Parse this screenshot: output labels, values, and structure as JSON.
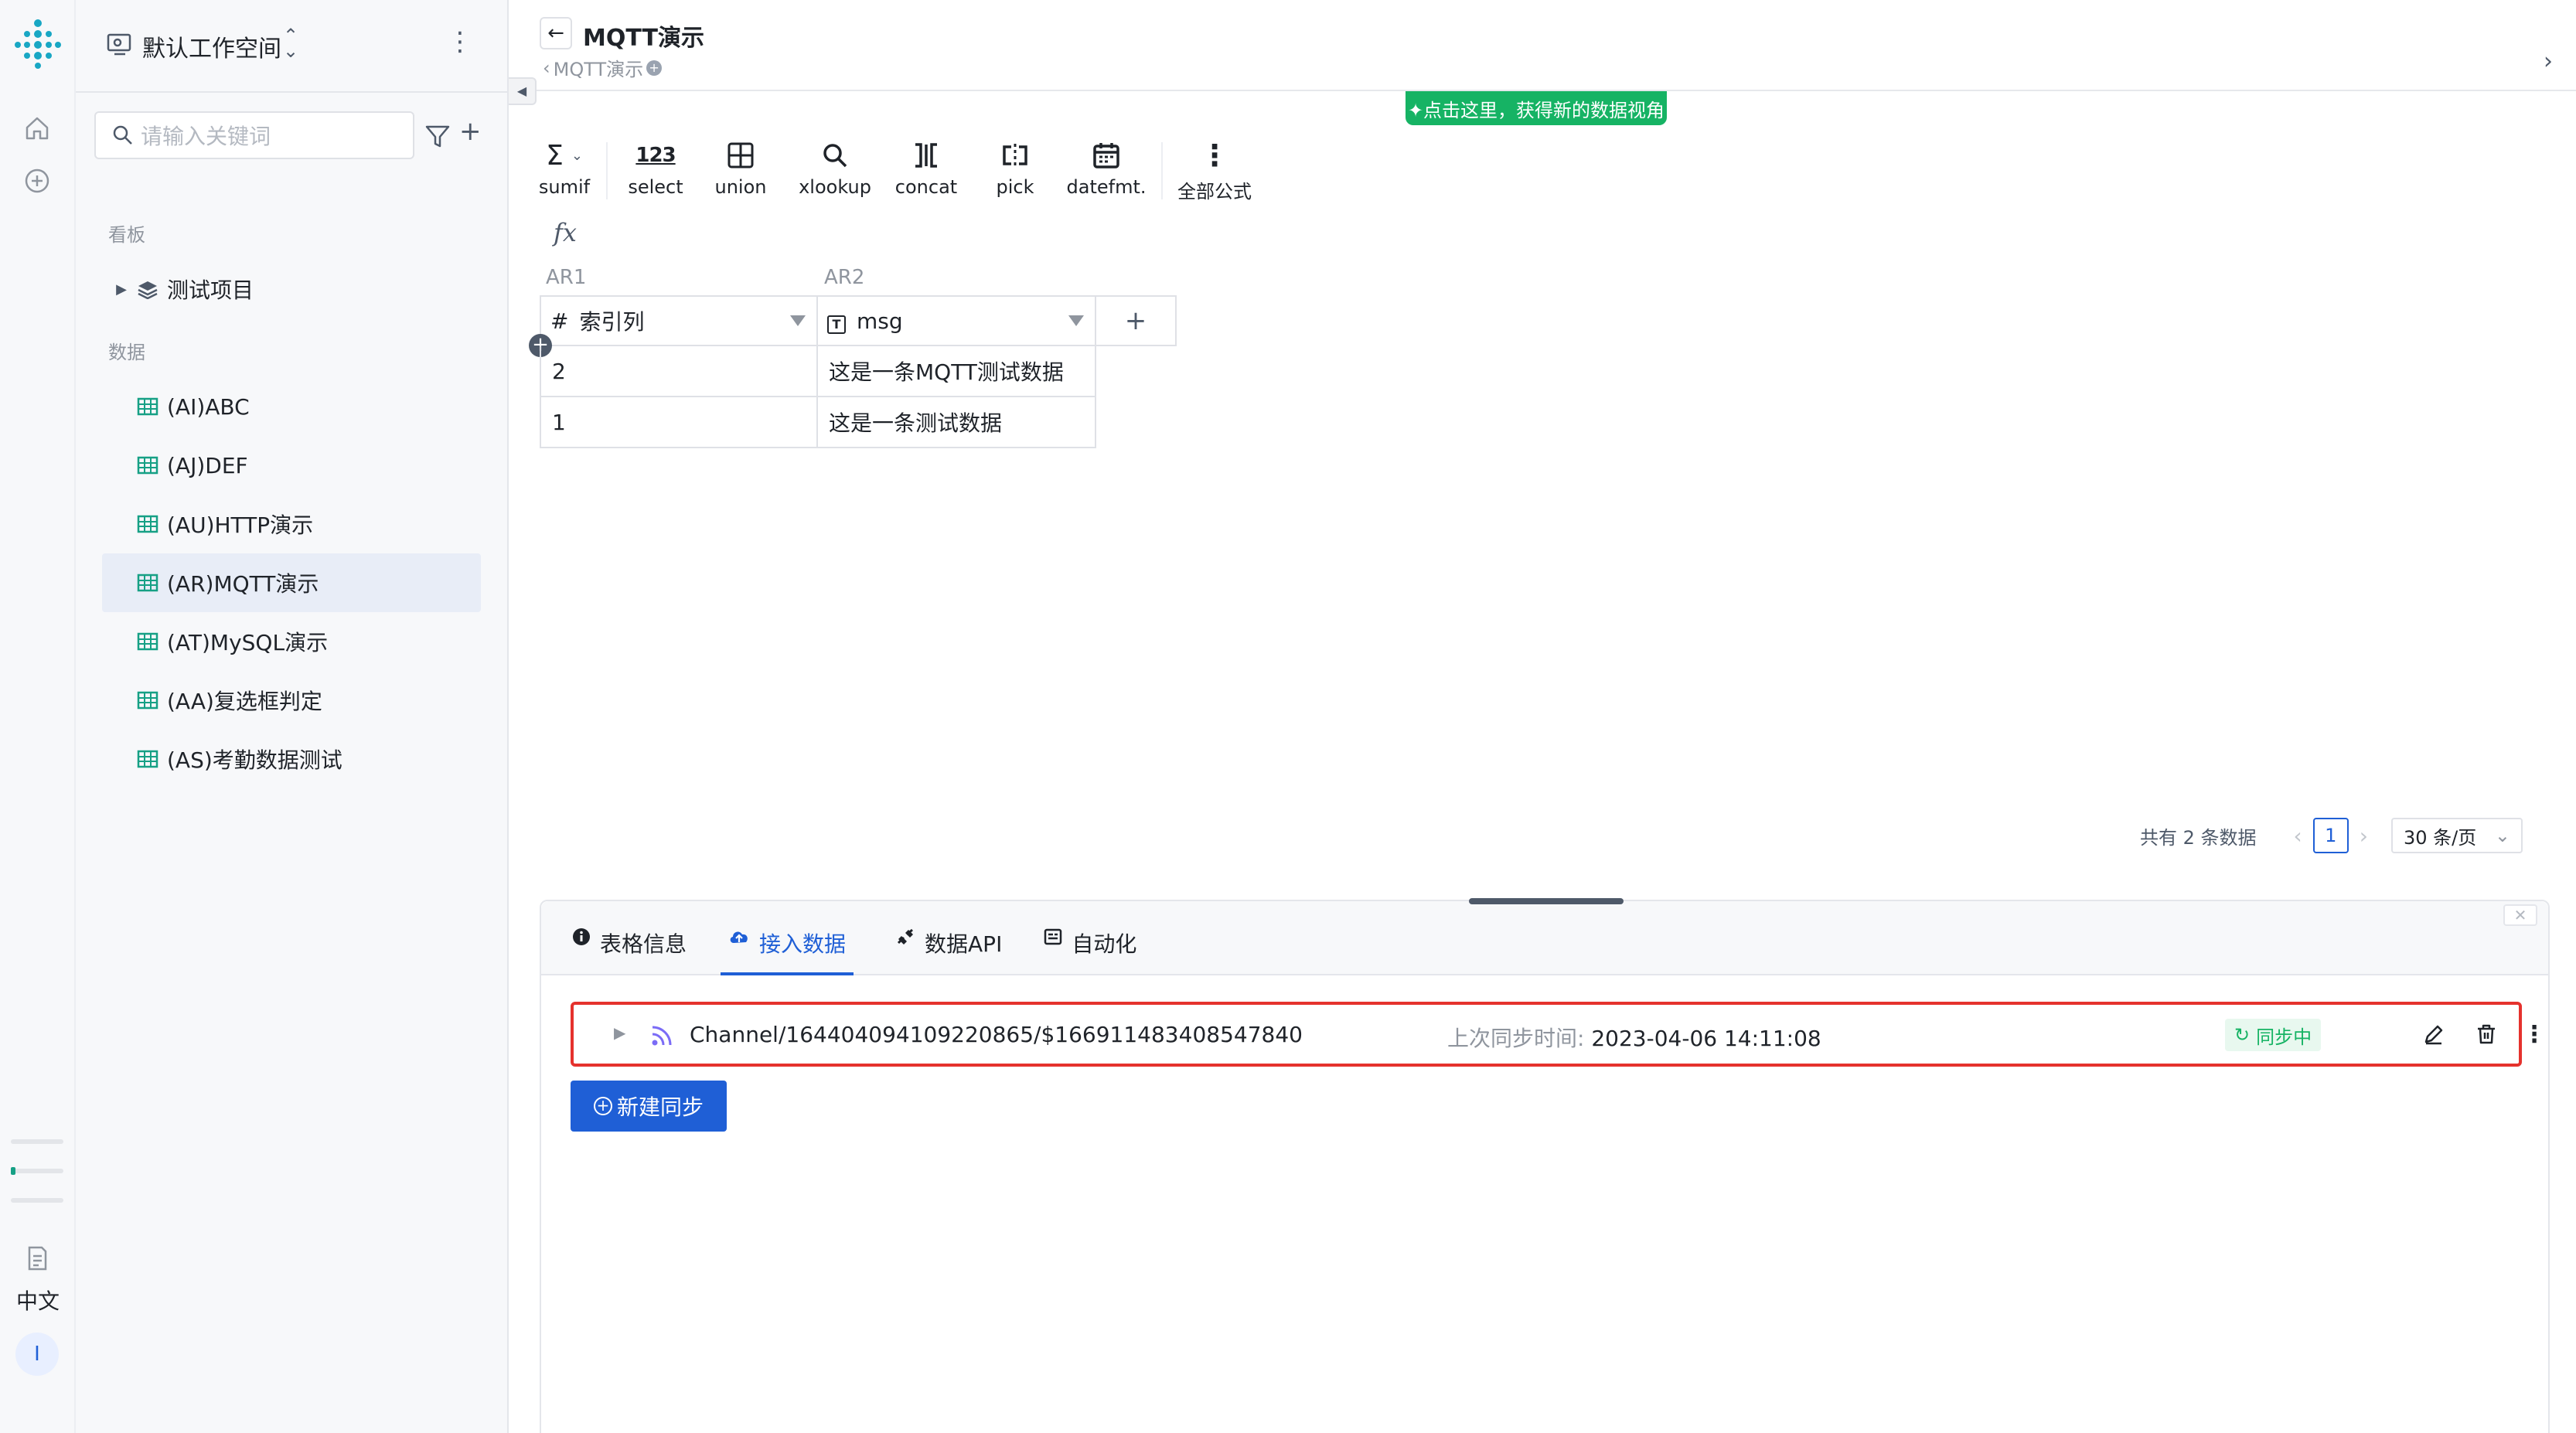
{
  "rail": {
    "lang_label": "中文",
    "avatar_initial": "I"
  },
  "sidebar": {
    "workspace_name": "默认工作空间",
    "search_placeholder": "请输入关键词",
    "section_board": "看板",
    "section_data": "数据",
    "board_items": [
      {
        "label": "测试项目"
      }
    ],
    "data_items": [
      {
        "label": "(AI)ABC"
      },
      {
        "label": "(AJ)DEF"
      },
      {
        "label": "(AU)HTTP演示"
      },
      {
        "label": "(AR)MQTT演示",
        "active": true
      },
      {
        "label": "(AT)MySQL演示"
      },
      {
        "label": "(AA)复选框判定"
      },
      {
        "label": "(AS)考勤数据测试"
      }
    ]
  },
  "header": {
    "title": "MQTT演示",
    "breadcrumb": "MQTT演示",
    "promo": "✦点击这里，获得新的数据视角"
  },
  "toolbar": {
    "tools": [
      {
        "icon": "sigma-icon",
        "label": "sumif"
      },
      {
        "icon": "number-icon",
        "label": "select"
      },
      {
        "icon": "union-icon",
        "label": "union"
      },
      {
        "icon": "search-icon",
        "label": "xlookup"
      },
      {
        "icon": "concat-icon",
        "label": "concat"
      },
      {
        "icon": "pick-icon",
        "label": "pick"
      },
      {
        "icon": "calendar-icon",
        "label": "datefmt."
      },
      {
        "icon": "more-vertical-icon",
        "label": "全部公式"
      }
    ],
    "fx": "fx"
  },
  "grid": {
    "columns": [
      {
        "letter": "AR1",
        "type_icon": "#",
        "name": "索引列"
      },
      {
        "letter": "AR2",
        "type_icon": "T",
        "name": "msg"
      }
    ],
    "add_column": "+",
    "rows": [
      [
        "2",
        "这是一条MQTT测试数据"
      ],
      [
        "1",
        "这是一条测试数据"
      ]
    ]
  },
  "pagination": {
    "total": "共有 2 条数据",
    "current_page": "1",
    "page_size": "30 条/页"
  },
  "panel": {
    "tabs": [
      {
        "label": "表格信息",
        "icon": "info-icon"
      },
      {
        "label": "接入数据",
        "icon": "cloud-icon",
        "active": true
      },
      {
        "label": "数据API",
        "icon": "api-icon"
      },
      {
        "label": "自动化",
        "icon": "automation-icon"
      }
    ],
    "sync": {
      "channel": "Channel/164404094109220865/$166911483408547840",
      "last_sync_label": "上次同步时间: ",
      "last_sync_time": "2023-04-06 14:11:08",
      "status": "同步中"
    },
    "new_sync_label": "新建同步"
  },
  "colors": {
    "accent": "#1f5fd6",
    "success": "#16b364",
    "highlight_border": "#e5322d",
    "table_icon": "#16a085"
  }
}
